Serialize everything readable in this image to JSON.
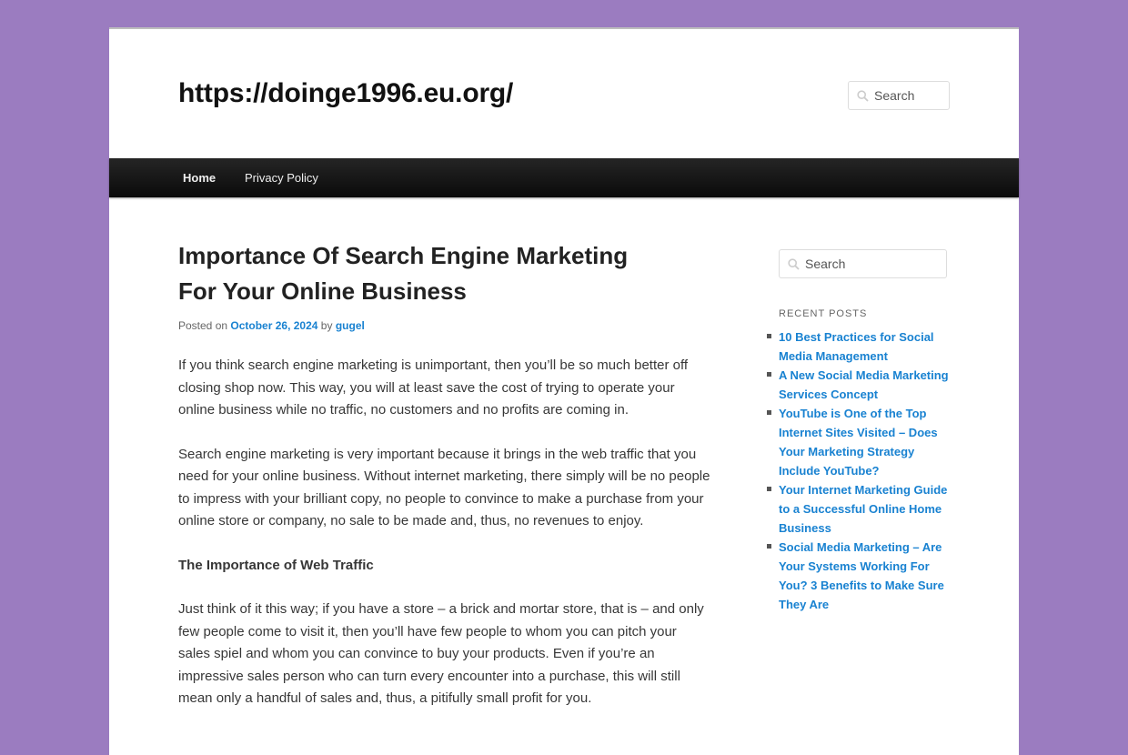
{
  "site": {
    "title": "https://doinge1996.eu.org/",
    "search_placeholder": "Search"
  },
  "nav": {
    "items": [
      {
        "label": "Home"
      },
      {
        "label": "Privacy Policy"
      }
    ]
  },
  "post": {
    "title": "Importance Of Search Engine Marketing For Your Online Business",
    "posted_on": "Posted on",
    "date": "October 26, 2024",
    "by": "by",
    "author": "gugel",
    "paragraphs": [
      "If you think search engine marketing is unimportant, then you’ll be so much better off closing shop now. This way, you will at least save the cost of trying to operate your online business while no traffic, no customers and no profits are coming in.",
      "Search engine marketing is very important because it brings in the web traffic that you need for your online business. Without internet marketing, there simply will be no people to impress with your brilliant copy, no people to convince to make a purchase from your online store or company, no sale to be made and, thus, no revenues to enjoy.",
      "The Importance of Web Traffic",
      "Just think of it this way; if you have a store – a brick and mortar store, that is – and only few people come to visit it, then you’ll have few people to whom you can pitch your sales spiel and whom you can convince to buy your products. Even if you’re an impressive sales person who can turn every encounter into a purchase, this will still mean only a handful of sales and, thus, a pitifully small profit for you."
    ]
  },
  "sidebar": {
    "search_placeholder": "Search",
    "recent_posts_title": "Recent Posts",
    "recent_posts": [
      {
        "label": "10 Best Practices for Social Media Management"
      },
      {
        "label": "A New Social Media Marketing Services Concept"
      },
      {
        "label": "YouTube is One of the Top Internet Sites Visited – Does Your Marketing Strategy Include YouTube?"
      },
      {
        "label": "Your Internet Marketing Guide to a Successful Online Home Business"
      },
      {
        "label": "Social Media Marketing – Are Your Systems Working For You? 3 Benefits to Make Sure They Are"
      }
    ]
  },
  "colors": {
    "background": "#9b7cc0",
    "link": "#1982d1",
    "nav_bar": "#111111"
  }
}
